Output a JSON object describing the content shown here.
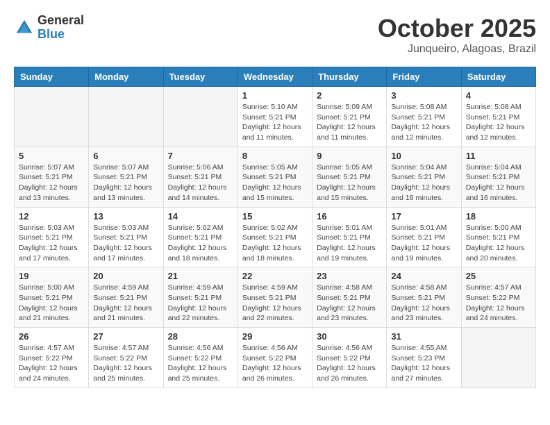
{
  "logo": {
    "general": "General",
    "blue": "Blue"
  },
  "header": {
    "month": "October 2025",
    "location": "Junqueiro, Alagoas, Brazil"
  },
  "weekdays": [
    "Sunday",
    "Monday",
    "Tuesday",
    "Wednesday",
    "Thursday",
    "Friday",
    "Saturday"
  ],
  "weeks": [
    [
      {
        "day": "",
        "sunrise": "",
        "sunset": "",
        "daylight": ""
      },
      {
        "day": "",
        "sunrise": "",
        "sunset": "",
        "daylight": ""
      },
      {
        "day": "",
        "sunrise": "",
        "sunset": "",
        "daylight": ""
      },
      {
        "day": "1",
        "sunrise": "Sunrise: 5:10 AM",
        "sunset": "Sunset: 5:21 PM",
        "daylight": "Daylight: 12 hours and 11 minutes."
      },
      {
        "day": "2",
        "sunrise": "Sunrise: 5:09 AM",
        "sunset": "Sunset: 5:21 PM",
        "daylight": "Daylight: 12 hours and 11 minutes."
      },
      {
        "day": "3",
        "sunrise": "Sunrise: 5:08 AM",
        "sunset": "Sunset: 5:21 PM",
        "daylight": "Daylight: 12 hours and 12 minutes."
      },
      {
        "day": "4",
        "sunrise": "Sunrise: 5:08 AM",
        "sunset": "Sunset: 5:21 PM",
        "daylight": "Daylight: 12 hours and 12 minutes."
      }
    ],
    [
      {
        "day": "5",
        "sunrise": "Sunrise: 5:07 AM",
        "sunset": "Sunset: 5:21 PM",
        "daylight": "Daylight: 12 hours and 13 minutes."
      },
      {
        "day": "6",
        "sunrise": "Sunrise: 5:07 AM",
        "sunset": "Sunset: 5:21 PM",
        "daylight": "Daylight: 12 hours and 13 minutes."
      },
      {
        "day": "7",
        "sunrise": "Sunrise: 5:06 AM",
        "sunset": "Sunset: 5:21 PM",
        "daylight": "Daylight: 12 hours and 14 minutes."
      },
      {
        "day": "8",
        "sunrise": "Sunrise: 5:05 AM",
        "sunset": "Sunset: 5:21 PM",
        "daylight": "Daylight: 12 hours and 15 minutes."
      },
      {
        "day": "9",
        "sunrise": "Sunrise: 5:05 AM",
        "sunset": "Sunset: 5:21 PM",
        "daylight": "Daylight: 12 hours and 15 minutes."
      },
      {
        "day": "10",
        "sunrise": "Sunrise: 5:04 AM",
        "sunset": "Sunset: 5:21 PM",
        "daylight": "Daylight: 12 hours and 16 minutes."
      },
      {
        "day": "11",
        "sunrise": "Sunrise: 5:04 AM",
        "sunset": "Sunset: 5:21 PM",
        "daylight": "Daylight: 12 hours and 16 minutes."
      }
    ],
    [
      {
        "day": "12",
        "sunrise": "Sunrise: 5:03 AM",
        "sunset": "Sunset: 5:21 PM",
        "daylight": "Daylight: 12 hours and 17 minutes."
      },
      {
        "day": "13",
        "sunrise": "Sunrise: 5:03 AM",
        "sunset": "Sunset: 5:21 PM",
        "daylight": "Daylight: 12 hours and 17 minutes."
      },
      {
        "day": "14",
        "sunrise": "Sunrise: 5:02 AM",
        "sunset": "Sunset: 5:21 PM",
        "daylight": "Daylight: 12 hours and 18 minutes."
      },
      {
        "day": "15",
        "sunrise": "Sunrise: 5:02 AM",
        "sunset": "Sunset: 5:21 PM",
        "daylight": "Daylight: 12 hours and 18 minutes."
      },
      {
        "day": "16",
        "sunrise": "Sunrise: 5:01 AM",
        "sunset": "Sunset: 5:21 PM",
        "daylight": "Daylight: 12 hours and 19 minutes."
      },
      {
        "day": "17",
        "sunrise": "Sunrise: 5:01 AM",
        "sunset": "Sunset: 5:21 PM",
        "daylight": "Daylight: 12 hours and 19 minutes."
      },
      {
        "day": "18",
        "sunrise": "Sunrise: 5:00 AM",
        "sunset": "Sunset: 5:21 PM",
        "daylight": "Daylight: 12 hours and 20 minutes."
      }
    ],
    [
      {
        "day": "19",
        "sunrise": "Sunrise: 5:00 AM",
        "sunset": "Sunset: 5:21 PM",
        "daylight": "Daylight: 12 hours and 21 minutes."
      },
      {
        "day": "20",
        "sunrise": "Sunrise: 4:59 AM",
        "sunset": "Sunset: 5:21 PM",
        "daylight": "Daylight: 12 hours and 21 minutes."
      },
      {
        "day": "21",
        "sunrise": "Sunrise: 4:59 AM",
        "sunset": "Sunset: 5:21 PM",
        "daylight": "Daylight: 12 hours and 22 minutes."
      },
      {
        "day": "22",
        "sunrise": "Sunrise: 4:59 AM",
        "sunset": "Sunset: 5:21 PM",
        "daylight": "Daylight: 12 hours and 22 minutes."
      },
      {
        "day": "23",
        "sunrise": "Sunrise: 4:58 AM",
        "sunset": "Sunset: 5:21 PM",
        "daylight": "Daylight: 12 hours and 23 minutes."
      },
      {
        "day": "24",
        "sunrise": "Sunrise: 4:58 AM",
        "sunset": "Sunset: 5:21 PM",
        "daylight": "Daylight: 12 hours and 23 minutes."
      },
      {
        "day": "25",
        "sunrise": "Sunrise: 4:57 AM",
        "sunset": "Sunset: 5:22 PM",
        "daylight": "Daylight: 12 hours and 24 minutes."
      }
    ],
    [
      {
        "day": "26",
        "sunrise": "Sunrise: 4:57 AM",
        "sunset": "Sunset: 5:22 PM",
        "daylight": "Daylight: 12 hours and 24 minutes."
      },
      {
        "day": "27",
        "sunrise": "Sunrise: 4:57 AM",
        "sunset": "Sunset: 5:22 PM",
        "daylight": "Daylight: 12 hours and 25 minutes."
      },
      {
        "day": "28",
        "sunrise": "Sunrise: 4:56 AM",
        "sunset": "Sunset: 5:22 PM",
        "daylight": "Daylight: 12 hours and 25 minutes."
      },
      {
        "day": "29",
        "sunrise": "Sunrise: 4:56 AM",
        "sunset": "Sunset: 5:22 PM",
        "daylight": "Daylight: 12 hours and 26 minutes."
      },
      {
        "day": "30",
        "sunrise": "Sunrise: 4:56 AM",
        "sunset": "Sunset: 5:22 PM",
        "daylight": "Daylight: 12 hours and 26 minutes."
      },
      {
        "day": "31",
        "sunrise": "Sunrise: 4:55 AM",
        "sunset": "Sunset: 5:23 PM",
        "daylight": "Daylight: 12 hours and 27 minutes."
      },
      {
        "day": "",
        "sunrise": "",
        "sunset": "",
        "daylight": ""
      }
    ]
  ]
}
